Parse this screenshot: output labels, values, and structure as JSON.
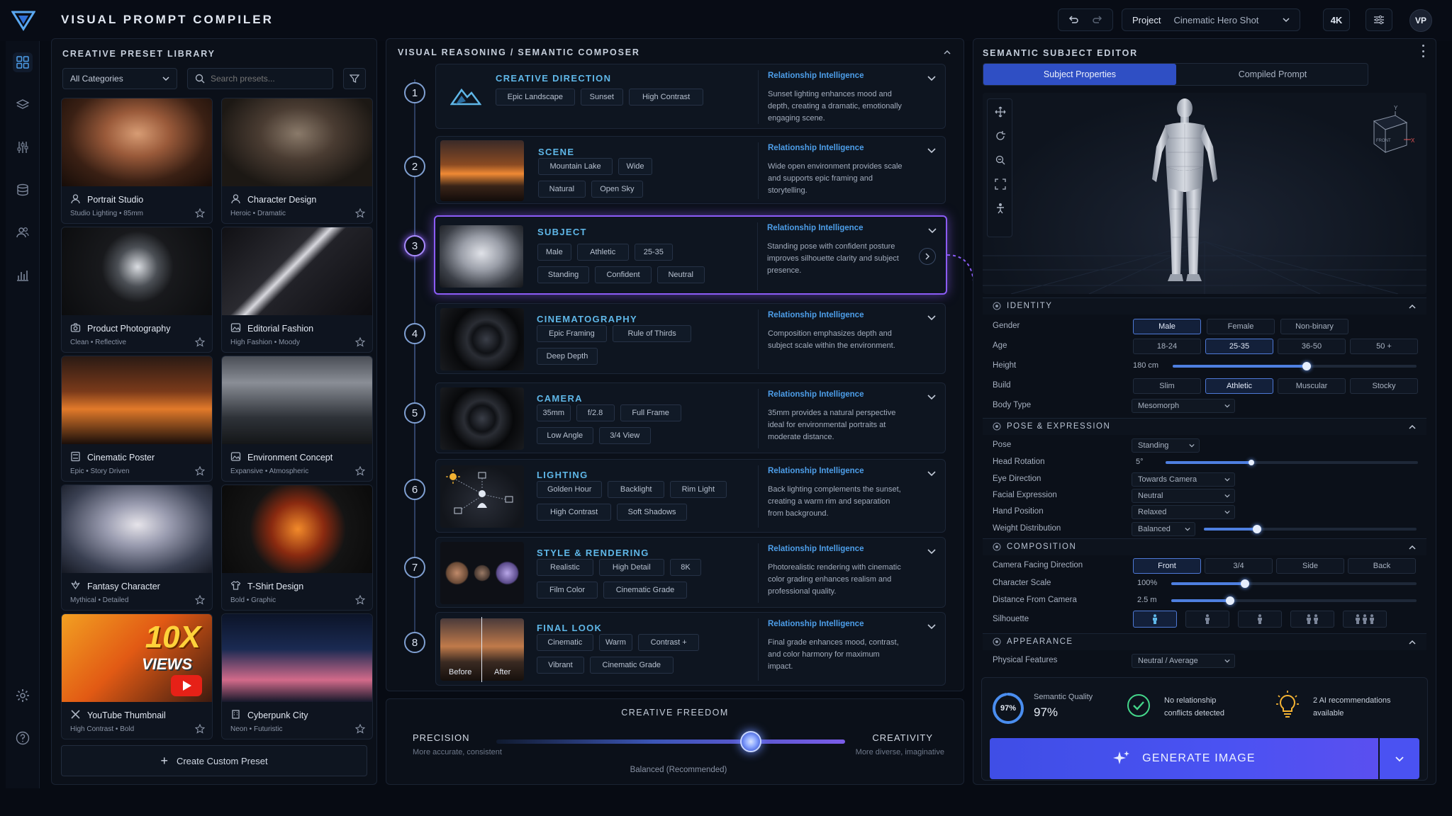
{
  "app": {
    "title": "VISUAL PROMPT COMPILER",
    "avatar": "VP"
  },
  "toolbar": {
    "project_label": "Project",
    "project_value": "Cinematic Hero Shot",
    "resolution": "4K"
  },
  "colors": {
    "accent": "#4a5cf0",
    "purple": "#8b5cf6",
    "cyan": "#5fb7e8",
    "ri_blue": "#4d9ee9",
    "green": "#44d68a",
    "gold": "#f2b233"
  },
  "library": {
    "title": "CREATIVE PRESET LIBRARY",
    "category": "All Categories",
    "search_placeholder": "Search presets...",
    "create_button": "Create Custom Preset",
    "presets": [
      {
        "name": "Portrait Studio",
        "sub": "Studio Lighting  •  85mm",
        "icon": "user-icon"
      },
      {
        "name": "Character Design",
        "sub": "Heroic  •  Dramatic",
        "icon": "user-icon"
      },
      {
        "name": "Product Photography",
        "sub": "Clean  •  Reflective",
        "icon": "camera-icon"
      },
      {
        "name": "Editorial Fashion",
        "sub": "High Fashion  •  Moody",
        "icon": "image-icon"
      },
      {
        "name": "Cinematic Poster",
        "sub": "Epic  •  Story Driven",
        "icon": "poster-icon"
      },
      {
        "name": "Environment Concept",
        "sub": "Expansive  •  Atmospheric",
        "icon": "image-icon"
      },
      {
        "name": "Fantasy Character",
        "sub": "Mythical  •  Detailed",
        "icon": "wings-icon"
      },
      {
        "name": "T-Shirt Design",
        "sub": "Bold  •  Graphic",
        "icon": "shirt-icon"
      },
      {
        "name": "YouTube Thumbnail",
        "sub": "High Contrast  •  Bold",
        "icon": "tools-icon",
        "overlay_big": "10X",
        "overlay_small": "VIEWS"
      },
      {
        "name": "Cyberpunk City",
        "sub": "Neon  •  Futuristic",
        "icon": "building-icon"
      }
    ]
  },
  "composer": {
    "title": "VISUAL REASONING / SEMANTIC COMPOSER",
    "ri_label": "Relationship Intelligence",
    "steps": [
      {
        "num": "1",
        "title": "CREATIVE DIRECTION",
        "tags": [
          "Epic Landscape",
          "Sunset",
          "High Contrast"
        ],
        "ri": "Sunset lighting enhances mood and depth, creating a dramatic, emotionally engaging scene."
      },
      {
        "num": "2",
        "title": "SCENE",
        "tags": [
          "Mountain Lake",
          "Wide",
          "Natural",
          "Open Sky"
        ],
        "ri": "Wide open environment provides scale and supports epic framing and storytelling."
      },
      {
        "num": "3",
        "title": "SUBJECT",
        "tags": [
          "Male",
          "Athletic",
          "25-35",
          "Standing",
          "Confident",
          "Neutral"
        ],
        "ri": "Standing pose with confident posture improves silhouette clarity and subject presence."
      },
      {
        "num": "4",
        "title": "CINEMATOGRAPHY",
        "tags": [
          "Epic Framing",
          "Rule of Thirds",
          "Deep Depth"
        ],
        "ri": "Composition emphasizes depth and subject scale within the environment."
      },
      {
        "num": "5",
        "title": "CAMERA",
        "tags": [
          "35mm",
          "f/2.8",
          "Full Frame",
          "Low Angle",
          "3/4 View"
        ],
        "ri": "35mm provides a natural perspective ideal for environmental portraits at moderate distance."
      },
      {
        "num": "6",
        "title": "LIGHTING",
        "tags": [
          "Golden Hour",
          "Backlight",
          "Rim Light",
          "High Contrast",
          "Soft Shadows"
        ],
        "ri": "Back lighting complements the sunset, creating a warm rim and separation from background."
      },
      {
        "num": "7",
        "title": "STYLE & RENDERING",
        "tags": [
          "Realistic",
          "High Detail",
          "8K",
          "Film Color",
          "Cinematic Grade"
        ],
        "ri": "Photorealistic rendering with cinematic color grading enhances realism and professional quality."
      },
      {
        "num": "8",
        "title": "FINAL LOOK",
        "tags": [
          "Cinematic",
          "Warm",
          "Contrast +",
          "Vibrant",
          "Cinematic Grade"
        ],
        "ri": "Final grade enhances mood, contrast, and color harmony for maximum impact.",
        "before": "Before",
        "after": "After"
      }
    ]
  },
  "freedom": {
    "title": "CREATIVE FREEDOM",
    "left_label": "PRECISION",
    "left_sub": "More accurate, consistent",
    "right_label": "CREATIVITY",
    "right_sub": "More diverse, imaginative",
    "caption": "Balanced (Recommended)",
    "value": 0.73
  },
  "editor": {
    "title": "SEMANTIC SUBJECT EDITOR",
    "tabs": [
      "Subject Properties",
      "Compiled Prompt"
    ],
    "gizmo_label": "FRONT",
    "identity": {
      "title": "IDENTITY",
      "gender_label": "Gender",
      "gender_options": [
        "Male",
        "Female",
        "Non-binary"
      ],
      "gender_selected": 0,
      "age_label": "Age",
      "age_options": [
        "18-24",
        "25-35",
        "36-50",
        "50 +"
      ],
      "age_selected": 1,
      "height_label": "Height",
      "height_value": "180 cm",
      "height_level": 0.55,
      "build_label": "Build",
      "build_options": [
        "Slim",
        "Athletic",
        "Muscular",
        "Stocky"
      ],
      "build_selected": 1,
      "body_label": "Body Type",
      "body_value": "Mesomorph"
    },
    "pose": {
      "title": "POSE & EXPRESSION",
      "pose_label": "Pose",
      "pose_value": "Standing",
      "head_label": "Head Rotation",
      "head_value": "5°",
      "head_level": 0.34,
      "eye_label": "Eye Direction",
      "eye_value": "Towards Camera",
      "face_label": "Facial Expression",
      "face_value": "Neutral",
      "hand_label": "Hand Position",
      "hand_value": "Relaxed",
      "weight_label": "Weight Distribution",
      "weight_value": "Balanced",
      "weight_level": 0.25
    },
    "composition": {
      "title": "COMPOSITION",
      "facing_label": "Camera Facing Direction",
      "facing_options": [
        "Front",
        "3/4",
        "Side",
        "Back"
      ],
      "facing_selected": 0,
      "scale_label": "Character Scale",
      "scale_value": "100%",
      "scale_level": 0.3,
      "distance_label": "Distance From Camera",
      "distance_value": "2.5 m",
      "distance_level": 0.24,
      "silhouette_label": "Silhouette"
    },
    "appearance": {
      "title": "APPEARANCE",
      "features_label": "Physical Features",
      "features_value": "Neutral / Average"
    }
  },
  "status": {
    "quality_label": "Semantic Quality",
    "quality_value": "97%",
    "quality_ring": "97%",
    "quality_level": 0.97,
    "conflicts": "No relationship conflicts detected",
    "recommendations": "2 AI recommendations available",
    "generate": "GENERATE IMAGE"
  }
}
